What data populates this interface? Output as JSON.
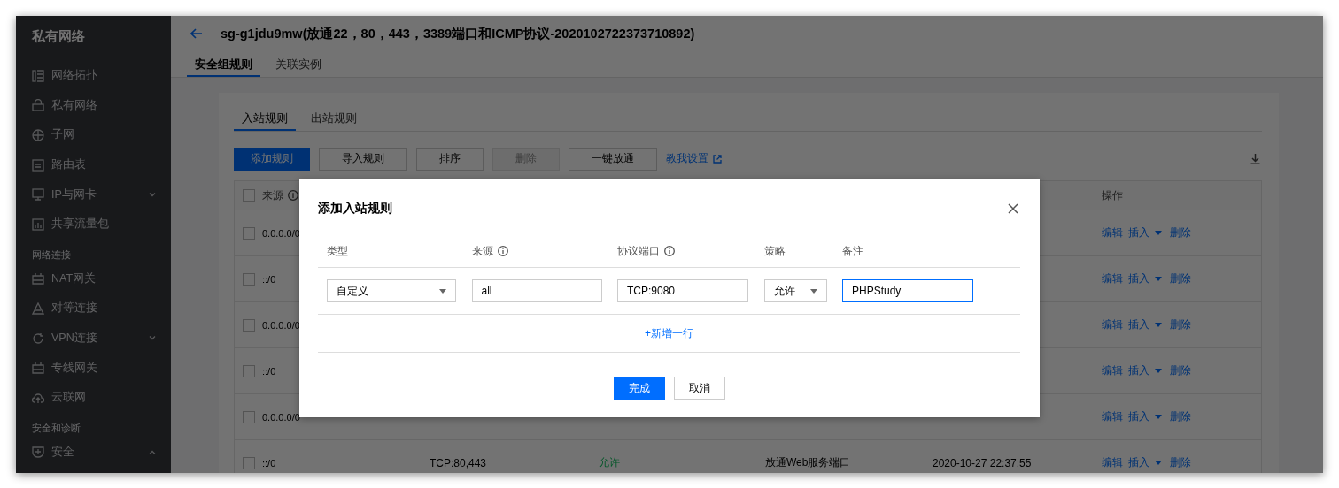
{
  "sidebar": {
    "title": "私有网络",
    "sections": [
      {
        "items": [
          {
            "label": "网络拓扑"
          },
          {
            "label": "私有网络"
          },
          {
            "label": "子网"
          },
          {
            "label": "路由表"
          },
          {
            "label": "IP与网卡",
            "expanded": false
          },
          {
            "label": "共享流量包"
          }
        ]
      },
      {
        "heading": "网络连接",
        "items": [
          {
            "label": "NAT网关"
          },
          {
            "label": "对等连接"
          },
          {
            "label": "VPN连接",
            "expanded": false
          },
          {
            "label": "专线网关"
          },
          {
            "label": "云联网"
          }
        ]
      },
      {
        "heading": "安全和诊断",
        "items": [
          {
            "label": "安全",
            "expanded": true
          }
        ]
      }
    ]
  },
  "header": {
    "title": "sg-g1jdu9mw(放通22，80，443，3389端口和ICMP协议-2020102722373710892)"
  },
  "tabs": [
    {
      "label": "安全组规则",
      "selected": true
    },
    {
      "label": "关联实例",
      "selected": false
    }
  ],
  "rule_tabs": [
    {
      "label": "入站规则",
      "selected": true
    },
    {
      "label": "出站规则",
      "selected": false
    }
  ],
  "toolbar": {
    "buttons": [
      {
        "label": "添加规则",
        "kind": "primary"
      },
      {
        "label": "导入规则",
        "kind": "default"
      },
      {
        "label": "排序",
        "kind": "default"
      },
      {
        "label": "删除",
        "kind": "disabled"
      },
      {
        "label": "一键放通",
        "kind": "default"
      }
    ],
    "link": "教我设置"
  },
  "table": {
    "header_checked": false,
    "columns": [
      {
        "label": "来源",
        "info": true
      },
      {
        "label": "操作",
        "info": false
      }
    ],
    "rows": [
      {
        "checked": false,
        "source": "0.0.0.0/0",
        "actions": [
          "编辑",
          "插入",
          "删除"
        ]
      },
      {
        "checked": false,
        "source": "::/0",
        "actions": [
          "编辑",
          "插入",
          "删除"
        ]
      },
      {
        "checked": false,
        "source": "0.0.0.0/0",
        "actions": [
          "编辑",
          "插入",
          "删除"
        ]
      },
      {
        "checked": false,
        "source": "::/0",
        "actions": [
          "编辑",
          "插入",
          "删除"
        ]
      },
      {
        "checked": false,
        "source": "0.0.0.0/0",
        "actions": [
          "编辑",
          "插入",
          "删除"
        ]
      },
      {
        "checked": false,
        "source": "::/0",
        "port": "TCP:80,443",
        "policy": "允许",
        "remark": "放通Web服务端口",
        "time": "2020-10-27 22:37:55",
        "actions": [
          "编辑",
          "插入",
          "删除"
        ]
      }
    ]
  },
  "modal": {
    "title": "添加入站规则",
    "columns": [
      {
        "label": "类型",
        "info": false
      },
      {
        "label": "来源",
        "info": true
      },
      {
        "label": "协议端口",
        "info": true
      },
      {
        "label": "策略",
        "info": false
      },
      {
        "label": "备注",
        "info": false
      }
    ],
    "fields": [
      {
        "kind": "select",
        "value": "自定义",
        "focused": false
      },
      {
        "kind": "input",
        "value": "all",
        "focused": false
      },
      {
        "kind": "input",
        "value": "TCP:9080",
        "focused": false
      },
      {
        "kind": "select",
        "value": "允许",
        "focused": false
      },
      {
        "kind": "input",
        "value": "PHPStudy",
        "focused": true
      }
    ],
    "add_row": "+新增一行",
    "buttons": [
      {
        "label": "完成",
        "kind": "primary"
      },
      {
        "label": "取消",
        "kind": "default"
      }
    ]
  }
}
